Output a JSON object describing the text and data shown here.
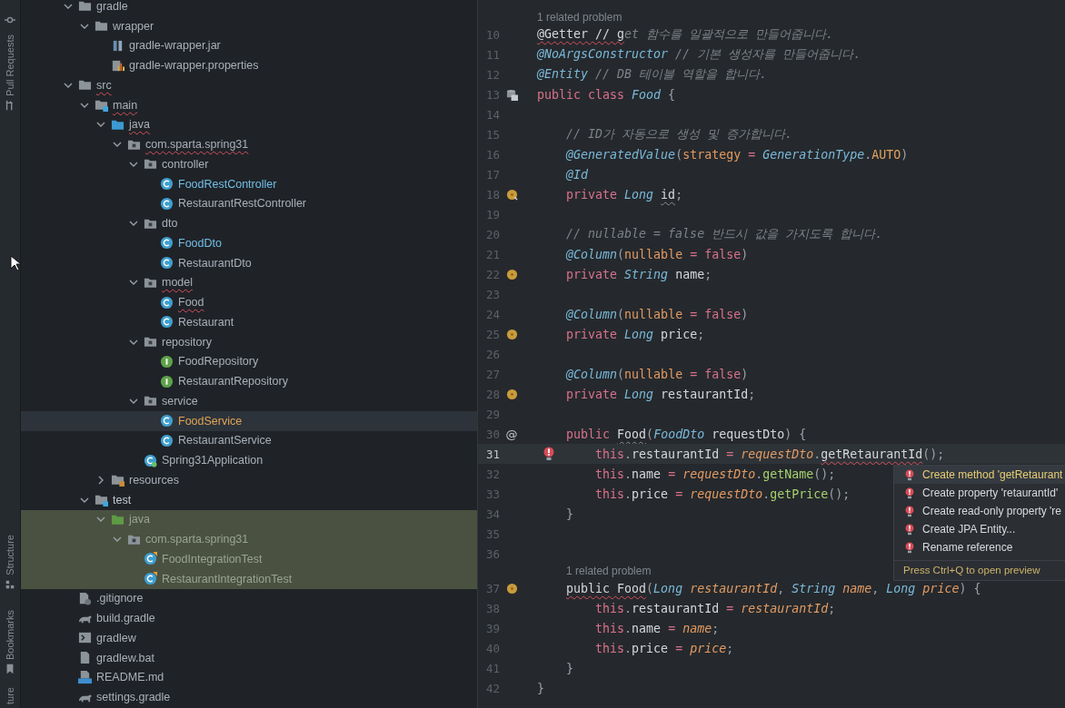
{
  "tool_stripe": {
    "labels": [
      "Pull Requests",
      "Structure",
      "Bookmarks",
      "ture"
    ]
  },
  "project_tree": [
    {
      "name": "gradle",
      "kind": "folder",
      "color": "#a9b0b8",
      "error": false,
      "selected": false,
      "tinted": false,
      "expanded": true,
      "children": [
        {
          "name": "wrapper",
          "kind": "folder",
          "color": "#a9b0b8",
          "error": false,
          "selected": false,
          "tinted": false,
          "expanded": true,
          "children": [
            {
              "name": "gradle-wrapper.jar",
              "kind": "jar",
              "color": "#a9b0b8",
              "error": false,
              "selected": false,
              "tinted": false
            },
            {
              "name": "gradle-wrapper.properties",
              "kind": "properties",
              "color": "#a9b0b8",
              "error": false,
              "selected": false,
              "tinted": false
            }
          ]
        }
      ]
    },
    {
      "name": "src",
      "kind": "folder",
      "color": "#a9b0b8",
      "error": true,
      "selected": false,
      "tinted": false,
      "expanded": true,
      "children": [
        {
          "name": "main",
          "kind": "module",
          "color": "#a9b0b8",
          "error": true,
          "selected": false,
          "tinted": false,
          "expanded": true,
          "children": [
            {
              "name": "java",
              "kind": "source",
              "color": "#a9b0b8",
              "error": true,
              "selected": false,
              "tinted": false,
              "expanded": true,
              "children": [
                {
                  "name": "com.sparta.spring31",
                  "kind": "package",
                  "color": "#a9b0b8",
                  "error": true,
                  "selected": false,
                  "tinted": false,
                  "expanded": true,
                  "children": [
                    {
                      "name": "controller",
                      "kind": "package",
                      "color": "#a9b0b8",
                      "error": false,
                      "selected": false,
                      "tinted": false,
                      "expanded": true,
                      "children": [
                        {
                          "name": "FoodRestController",
                          "kind": "class",
                          "color": "#72bfe6",
                          "error": false,
                          "selected": false,
                          "tinted": false
                        },
                        {
                          "name": "RestaurantRestController",
                          "kind": "class",
                          "color": "#a9b0b8",
                          "error": false,
                          "selected": false,
                          "tinted": false
                        }
                      ]
                    },
                    {
                      "name": "dto",
                      "kind": "package",
                      "color": "#a9b0b8",
                      "error": false,
                      "selected": false,
                      "tinted": false,
                      "expanded": true,
                      "children": [
                        {
                          "name": "FoodDto",
                          "kind": "class",
                          "color": "#72bfe6",
                          "error": false,
                          "selected": false,
                          "tinted": false
                        },
                        {
                          "name": "RestaurantDto",
                          "kind": "class",
                          "color": "#a9b0b8",
                          "error": false,
                          "selected": false,
                          "tinted": false
                        }
                      ]
                    },
                    {
                      "name": "model",
                      "kind": "package",
                      "color": "#a9b0b8",
                      "error": true,
                      "selected": false,
                      "tinted": false,
                      "expanded": true,
                      "children": [
                        {
                          "name": "Food",
                          "kind": "class",
                          "color": "#a9b0b8",
                          "error": true,
                          "selected": false,
                          "tinted": false
                        },
                        {
                          "name": "Restaurant",
                          "kind": "class",
                          "color": "#a9b0b8",
                          "error": false,
                          "selected": false,
                          "tinted": false
                        }
                      ]
                    },
                    {
                      "name": "repository",
                      "kind": "package",
                      "color": "#a9b0b8",
                      "error": false,
                      "selected": false,
                      "tinted": false,
                      "expanded": true,
                      "children": [
                        {
                          "name": "FoodRepository",
                          "kind": "interface",
                          "color": "#a9b0b8",
                          "error": false,
                          "selected": false,
                          "tinted": false
                        },
                        {
                          "name": "RestaurantRepository",
                          "kind": "interface",
                          "color": "#a9b0b8",
                          "error": false,
                          "selected": false,
                          "tinted": false
                        }
                      ]
                    },
                    {
                      "name": "service",
                      "kind": "package",
                      "color": "#a9b0b8",
                      "error": false,
                      "selected": false,
                      "tinted": false,
                      "expanded": true,
                      "children": [
                        {
                          "name": "FoodService",
                          "kind": "class",
                          "color": "#e0a458",
                          "error": false,
                          "selected": true,
                          "tinted": false
                        },
                        {
                          "name": "RestaurantService",
                          "kind": "class",
                          "color": "#a9b0b8",
                          "error": false,
                          "selected": false,
                          "tinted": false
                        }
                      ]
                    },
                    {
                      "name": "Spring31Application",
                      "kind": "app",
                      "color": "#a9b0b8",
                      "error": false,
                      "selected": false,
                      "tinted": false
                    }
                  ]
                }
              ]
            },
            {
              "name": "resources",
              "kind": "resources",
              "color": "#a9b0b8",
              "error": false,
              "selected": false,
              "tinted": false,
              "expanded": false
            }
          ]
        },
        {
          "name": "test",
          "kind": "module",
          "color": "#c4c9ce",
          "error": false,
          "selected": false,
          "tinted": false,
          "expanded": true,
          "children": [
            {
              "name": "java",
              "kind": "test-source",
              "color": "#9aa392",
              "error": false,
              "selected": false,
              "tinted": true,
              "expanded": true,
              "children": [
                {
                  "name": "com.sparta.spring31",
                  "kind": "package",
                  "color": "#9aa392",
                  "error": false,
                  "selected": false,
                  "tinted": true,
                  "expanded": true,
                  "children": [
                    {
                      "name": "FoodIntegrationTest",
                      "kind": "test-class",
                      "color": "#9aa392",
                      "error": false,
                      "selected": false,
                      "tinted": true
                    },
                    {
                      "name": "RestaurantIntegrationTest",
                      "kind": "test-class",
                      "color": "#9aa392",
                      "error": false,
                      "selected": false,
                      "tinted": true
                    }
                  ]
                }
              ]
            }
          ]
        }
      ]
    },
    {
      "name": ".gitignore",
      "kind": "ignore",
      "color": "#a9b0b8",
      "error": false,
      "selected": false,
      "tinted": false
    },
    {
      "name": "build.gradle",
      "kind": "gradle",
      "color": "#a9b0b8",
      "error": false,
      "selected": false,
      "tinted": false
    },
    {
      "name": "gradlew",
      "kind": "shell",
      "color": "#a9b0b8",
      "error": false,
      "selected": false,
      "tinted": false
    },
    {
      "name": "gradlew.bat",
      "kind": "bat",
      "color": "#a9b0b8",
      "error": false,
      "selected": false,
      "tinted": false
    },
    {
      "name": "README.md",
      "kind": "md",
      "color": "#a9b0b8",
      "error": false,
      "selected": false,
      "tinted": false
    },
    {
      "name": "settings.gradle",
      "kind": "gradle",
      "color": "#a9b0b8",
      "error": false,
      "selected": false,
      "tinted": false
    }
  ],
  "editor": {
    "lines": [
      {
        "number": "10",
        "current": false,
        "inlay": "1 related problem",
        "tokens": [
          {
            "text": "@Getter // g",
            "kind": "error"
          },
          {
            "text": "et 함수를 일괄적으로 만들어줍니다.",
            "kind": "comment"
          }
        ]
      },
      {
        "number": "11",
        "current": false,
        "tokens": [
          {
            "text": "@NoArgsConstructor",
            "kind": "annotation"
          },
          {
            "text": " // 기본 생성자를 만들어줍니다.",
            "kind": "comment"
          }
        ]
      },
      {
        "number": "12",
        "current": false,
        "tokens": [
          {
            "text": "@Entity",
            "kind": "annotation"
          },
          {
            "text": " // DB 테이블 역할을 합니다.",
            "kind": "comment"
          }
        ]
      },
      {
        "number": "13",
        "current": false,
        "marker": {
          "kind": "db"
        },
        "tokens": [
          {
            "text": "public class ",
            "kind": "keyword"
          },
          {
            "text": "Food",
            "kind": "type"
          },
          {
            "text": " {",
            "kind": "punctuation"
          }
        ]
      },
      {
        "number": "14",
        "current": false
      },
      {
        "number": "15",
        "current": false,
        "tokens": [
          {
            "text": "    // ID가 자동으로 생성 및 증가합니다.",
            "kind": "comment"
          }
        ]
      },
      {
        "number": "16",
        "current": false,
        "tokens": [
          {
            "text": "    @GeneratedValue",
            "kind": "annotation"
          },
          {
            "text": "(",
            "kind": "punctuation"
          },
          {
            "text": "strategy",
            "kind": "parameter"
          },
          {
            "text": " = ",
            "kind": "operator"
          },
          {
            "text": "GenerationType",
            "kind": "type"
          },
          {
            "text": ".",
            "kind": "punctuation"
          },
          {
            "text": "AUTO",
            "kind": "constant"
          },
          {
            "text": ")",
            "kind": "punctuation"
          }
        ]
      },
      {
        "number": "17",
        "current": false,
        "tokens": [
          {
            "text": "    @Id",
            "kind": "annotation"
          }
        ]
      },
      {
        "number": "18",
        "current": false,
        "marker": {
          "kind": "bean-link"
        },
        "tokens": [
          {
            "text": "    private ",
            "kind": "keyword"
          },
          {
            "text": "Long ",
            "kind": "type"
          },
          {
            "text": "id",
            "kind": "warning"
          },
          {
            "text": ";",
            "kind": "punctuation"
          }
        ]
      },
      {
        "number": "19",
        "current": false
      },
      {
        "number": "20",
        "current": false,
        "tokens": [
          {
            "text": "    // nullable = false 반드시 값을 가지도록 합니다.",
            "kind": "comment"
          }
        ]
      },
      {
        "number": "21",
        "current": false,
        "tokens": [
          {
            "text": "    @Column",
            "kind": "annotation"
          },
          {
            "text": "(",
            "kind": "punctuation"
          },
          {
            "text": "nullable",
            "kind": "parameter"
          },
          {
            "text": " = ",
            "kind": "operator"
          },
          {
            "text": "false",
            "kind": "keyword"
          },
          {
            "text": ")",
            "kind": "punctuation"
          }
        ]
      },
      {
        "number": "22",
        "current": false,
        "marker": {
          "kind": "bean"
        },
        "tokens": [
          {
            "text": "    private ",
            "kind": "keyword"
          },
          {
            "text": "String",
            "kind": "type"
          },
          {
            "text": " name",
            "kind": "plain"
          },
          {
            "text": ";",
            "kind": "punctuation"
          }
        ]
      },
      {
        "number": "23",
        "current": false
      },
      {
        "number": "24",
        "current": false,
        "tokens": [
          {
            "text": "    @Column",
            "kind": "annotation"
          },
          {
            "text": "(",
            "kind": "punctuation"
          },
          {
            "text": "nullable",
            "kind": "parameter"
          },
          {
            "text": " = ",
            "kind": "operator"
          },
          {
            "text": "false",
            "kind": "keyword"
          },
          {
            "text": ")",
            "kind": "punctuation"
          }
        ]
      },
      {
        "number": "25",
        "current": false,
        "marker": {
          "kind": "bean"
        },
        "tokens": [
          {
            "text": "    private ",
            "kind": "keyword"
          },
          {
            "text": "Long",
            "kind": "type"
          },
          {
            "text": " price",
            "kind": "plain"
          },
          {
            "text": ";",
            "kind": "punctuation"
          }
        ]
      },
      {
        "number": "26",
        "current": false
      },
      {
        "number": "27",
        "current": false,
        "tokens": [
          {
            "text": "    @Column",
            "kind": "annotation"
          },
          {
            "text": "(",
            "kind": "punctuation"
          },
          {
            "text": "nullable",
            "kind": "parameter"
          },
          {
            "text": " = ",
            "kind": "operator"
          },
          {
            "text": "false",
            "kind": "keyword"
          },
          {
            "text": ")",
            "kind": "punctuation"
          }
        ]
      },
      {
        "number": "28",
        "current": false,
        "marker": {
          "kind": "bean"
        },
        "tokens": [
          {
            "text": "    private ",
            "kind": "keyword"
          },
          {
            "text": "Long",
            "kind": "type"
          },
          {
            "text": " restaurantId",
            "kind": "plain"
          },
          {
            "text": ";",
            "kind": "punctuation"
          }
        ]
      },
      {
        "number": "29",
        "current": false
      },
      {
        "number": "30",
        "current": false,
        "gutter": "@",
        "tokens": [
          {
            "text": "    public ",
            "kind": "keyword"
          },
          {
            "text": "Food",
            "kind": "warning"
          },
          {
            "text": "(",
            "kind": "punctuation"
          },
          {
            "text": "FoodDto",
            "kind": "type"
          },
          {
            "text": " requestDto",
            "kind": "plain"
          },
          {
            "text": ") {",
            "kind": "punctuation"
          }
        ]
      },
      {
        "number": "31",
        "current": true,
        "tokens": [
          {
            "text": "        this",
            "kind": "keyword"
          },
          {
            "text": ".",
            "kind": "punctuation"
          },
          {
            "text": "restaurantId",
            "kind": "plain"
          },
          {
            "text": " = ",
            "kind": "operator"
          },
          {
            "text": "requestDto",
            "kind": "variable"
          },
          {
            "text": ".",
            "kind": "punctuation"
          },
          {
            "text": "getRetaurantId",
            "kind": "error"
          },
          {
            "text": "();",
            "kind": "punctuation"
          }
        ]
      },
      {
        "number": "32",
        "current": false,
        "tokens": [
          {
            "text": "        this",
            "kind": "keyword"
          },
          {
            "text": ".",
            "kind": "punctuation"
          },
          {
            "text": "name",
            "kind": "plain"
          },
          {
            "text": " = ",
            "kind": "operator"
          },
          {
            "text": "requestDto",
            "kind": "variable"
          },
          {
            "text": ".",
            "kind": "punctuation"
          },
          {
            "text": "getName",
            "kind": "method"
          },
          {
            "text": "();",
            "kind": "punctuation"
          }
        ]
      },
      {
        "number": "33",
        "current": false,
        "tokens": [
          {
            "text": "        this",
            "kind": "keyword"
          },
          {
            "text": ".",
            "kind": "punctuation"
          },
          {
            "text": "price",
            "kind": "plain"
          },
          {
            "text": " = ",
            "kind": "operator"
          },
          {
            "text": "requestDto",
            "kind": "variable"
          },
          {
            "text": ".",
            "kind": "punctuation"
          },
          {
            "text": "getPrice",
            "kind": "method"
          },
          {
            "text": "();",
            "kind": "punctuation"
          }
        ]
      },
      {
        "number": "34",
        "current": false,
        "tokens": [
          {
            "text": "    }",
            "kind": "punctuation"
          }
        ]
      },
      {
        "number": "35",
        "current": false
      },
      {
        "number": "36",
        "current": false
      },
      {
        "number": "37",
        "current": false,
        "marker": {
          "kind": "bean"
        },
        "inlay": "1 related problem",
        "tokens": [
          {
            "text": "    public Food",
            "kind": "error"
          },
          {
            "text": "(",
            "kind": "punctuation"
          },
          {
            "text": "Long",
            "kind": "type"
          },
          {
            "text": " restaurantId",
            "kind": "variable"
          },
          {
            "text": ", ",
            "kind": "punctuation"
          },
          {
            "text": "String",
            "kind": "type"
          },
          {
            "text": " name",
            "kind": "variable"
          },
          {
            "text": ", ",
            "kind": "punctuation"
          },
          {
            "text": "Long",
            "kind": "type"
          },
          {
            "text": " price",
            "kind": "variable"
          },
          {
            "text": ") {",
            "kind": "punctuation"
          }
        ]
      },
      {
        "number": "38",
        "current": false,
        "tokens": [
          {
            "text": "        this",
            "kind": "keyword"
          },
          {
            "text": ".",
            "kind": "punctuation"
          },
          {
            "text": "restaurantId",
            "kind": "plain"
          },
          {
            "text": " = ",
            "kind": "operator"
          },
          {
            "text": "restaurantId",
            "kind": "variable"
          },
          {
            "text": ";",
            "kind": "punctuation"
          }
        ]
      },
      {
        "number": "39",
        "current": false,
        "tokens": [
          {
            "text": "        this",
            "kind": "keyword"
          },
          {
            "text": ".",
            "kind": "punctuation"
          },
          {
            "text": "name",
            "kind": "plain"
          },
          {
            "text": " = ",
            "kind": "operator"
          },
          {
            "text": "name",
            "kind": "variable"
          },
          {
            "text": ";",
            "kind": "punctuation"
          }
        ]
      },
      {
        "number": "40",
        "current": false,
        "tokens": [
          {
            "text": "        this",
            "kind": "keyword"
          },
          {
            "text": ".",
            "kind": "punctuation"
          },
          {
            "text": "price",
            "kind": "plain"
          },
          {
            "text": " = ",
            "kind": "operator"
          },
          {
            "text": "price",
            "kind": "variable"
          },
          {
            "text": ";",
            "kind": "punctuation"
          }
        ]
      },
      {
        "number": "41",
        "current": false,
        "tokens": [
          {
            "text": "    }",
            "kind": "punctuation"
          }
        ]
      },
      {
        "number": "42",
        "current": false,
        "tokens": [
          {
            "text": "}",
            "kind": "punctuation"
          }
        ]
      }
    ]
  },
  "quick_fix_popup": {
    "items": [
      {
        "label": "Create method 'getRetaurant",
        "selected": true
      },
      {
        "label": "Create property 'retaurantId'",
        "selected": false
      },
      {
        "label": "Create read-only property 're",
        "selected": false
      },
      {
        "label": "Create JPA Entity...",
        "selected": false
      },
      {
        "label": "Rename reference",
        "selected": false
      }
    ],
    "hint": "Press Ctrl+Q to open preview"
  }
}
